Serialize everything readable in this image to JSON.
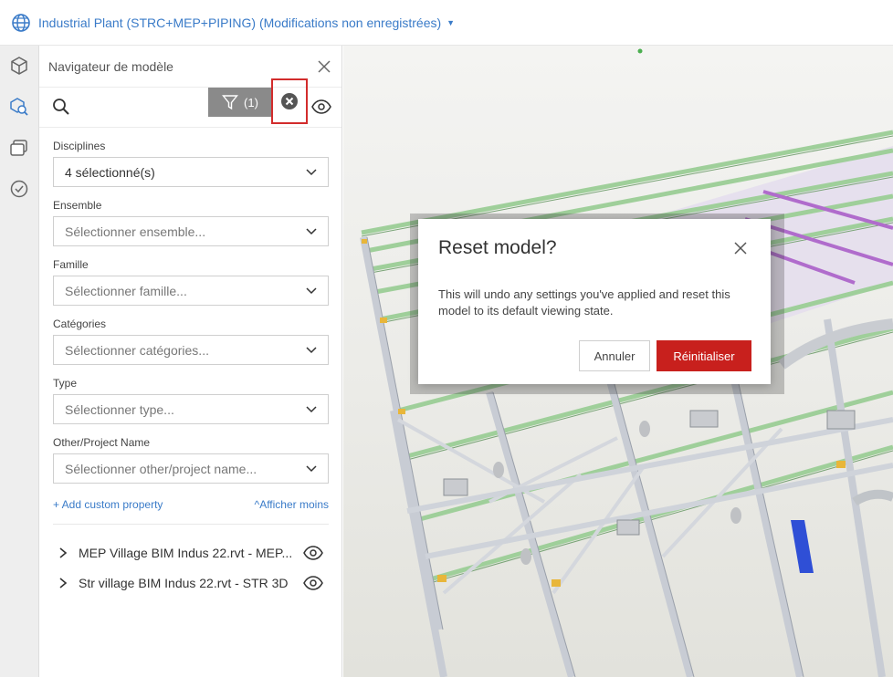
{
  "header": {
    "title": "Industrial Plant (STRC+MEP+PIPING) (Modifications non enregistrées)"
  },
  "colors": {
    "accent": "#3a7bc8",
    "danger": "#c8201d",
    "highlight_box": "#d22c2c"
  },
  "rail": {
    "icons": [
      "cube-icon",
      "model-browser-icon",
      "layers-icon",
      "check-circle-icon"
    ]
  },
  "panel": {
    "title": "Navigateur de modèle",
    "filter_count": "(1)",
    "fields": [
      {
        "label": "Disciplines",
        "value": "4 sélectionné(s)",
        "placeholder": false
      },
      {
        "label": "Ensemble",
        "value": "Sélectionner ensemble...",
        "placeholder": true
      },
      {
        "label": "Famille",
        "value": "Sélectionner famille...",
        "placeholder": true
      },
      {
        "label": "Catégories",
        "value": "Sélectionner catégories...",
        "placeholder": true
      },
      {
        "label": "Type",
        "value": "Sélectionner type...",
        "placeholder": true
      },
      {
        "label": "Other/Project Name",
        "value": "Sélectionner other/project name...",
        "placeholder": true
      }
    ],
    "add_custom_property": "+ Add custom property",
    "show_less": "Afficher moins",
    "tree": [
      {
        "label": "MEP Village BIM Indus 22.rvt - MEP..."
      },
      {
        "label": "Str village BIM Indus 22.rvt - STR 3D"
      }
    ]
  },
  "modal": {
    "title": "Reset model?",
    "body": "This will undo any settings you've applied and reset this model to its default viewing state.",
    "cancel_label": "Annuler",
    "confirm_label": "Réinitialiser"
  }
}
